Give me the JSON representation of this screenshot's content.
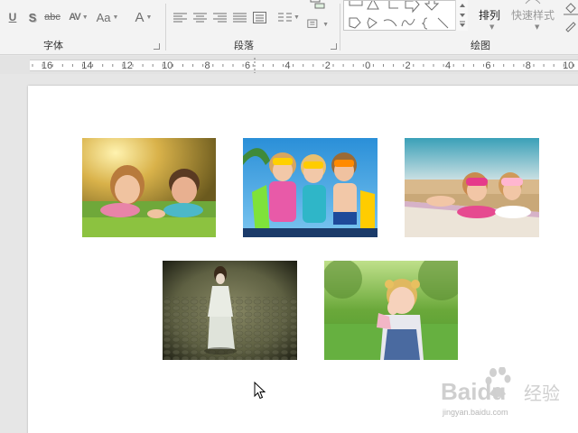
{
  "ribbon": {
    "font_group": {
      "label": "字体",
      "strike_label": "abc",
      "spacing_label": "AV",
      "case_label": "Aa",
      "font_color_label": "A"
    },
    "paragraph_group": {
      "label": "段落"
    },
    "drawing_group": {
      "label": "绘图",
      "arrange_label": "排列",
      "quick_styles_label": "快速样式"
    }
  },
  "ruler": {
    "labels": [
      "16",
      "14",
      "12",
      "10",
      "8",
      "6",
      "4",
      "2",
      "0",
      "2",
      "4",
      "6",
      "8",
      "10"
    ]
  },
  "photos": [
    {
      "name": "photo-kids-on-grass",
      "subject": "two children lying on grass"
    },
    {
      "name": "photo-kids-with-snorkels",
      "subject": "three children with snorkel masks and flippers"
    },
    {
      "name": "photo-kids-on-beach",
      "subject": "two girls lying on beach towel with goggles"
    },
    {
      "name": "photo-girl-on-cobblestones",
      "subject": "girl kneeling on cobblestone path"
    },
    {
      "name": "photo-girl-in-park",
      "subject": "toddler girl in park with pigtails"
    }
  ],
  "watermark": {
    "brand": "Baidu",
    "suffix": "经验",
    "url": "jingyan.baidu.com"
  },
  "colors": {
    "ribbon_bg": "#f3f3f3",
    "workspace_bg": "#e6e6e6",
    "slide_bg": "#ffffff",
    "icon_gray": "#6f6f6f"
  }
}
